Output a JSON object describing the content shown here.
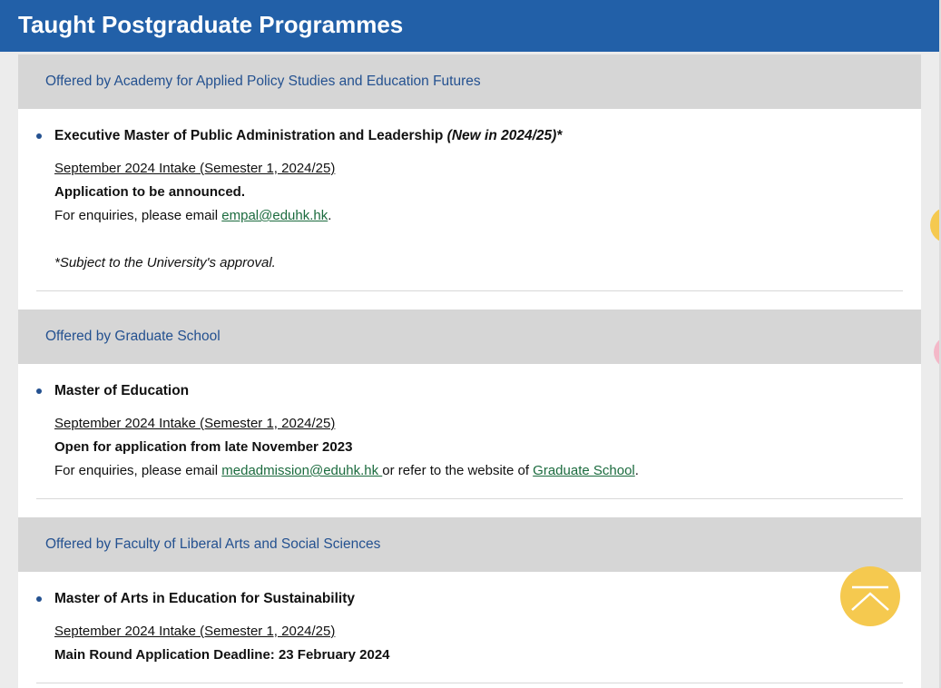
{
  "page": {
    "title": "Taught Postgraduate Programmes"
  },
  "sections": [
    {
      "offered_by": "Offered by Academy for Applied Policy Studies and Education Futures",
      "programme": {
        "title": "Executive Master of Public Administration and Leadership",
        "tag": "(New in 2024/25)*",
        "intake": "September 2024 Intake (Semester 1, 2024/25)",
        "status": "Application to be announced.",
        "enquiry_prefix": "For enquiries, please email ",
        "email": "empal@eduhk.hk",
        "enquiry_suffix": ".",
        "note": "*Subject to the University's approval."
      }
    },
    {
      "offered_by": "Offered by Graduate School",
      "programme": {
        "title": "Master of Education",
        "intake": "September 2024 Intake (Semester 1, 2024/25)",
        "status": "Open for application from late November 2023",
        "enquiry_prefix": "For enquiries, please email ",
        "email": "medadmission@eduhk.hk ",
        "enquiry_middle": "or refer to the website of ",
        "website_link": "Graduate School",
        "enquiry_suffix": "."
      }
    },
    {
      "offered_by": "Offered by Faculty of Liberal Arts and Social Sciences",
      "programme": {
        "title": "Master of Arts in Education for Sustainability",
        "intake": "September 2024 Intake (Semester 1, 2024/25)",
        "status": "Main Round Application Deadline: 23 February 2024"
      }
    }
  ],
  "icons": {
    "back_to_top": "chevron-up-icon"
  },
  "colors": {
    "header": "#2260a8",
    "section_title": "#245190",
    "link": "#1b6b3e",
    "back_to_top": "#f5c94f"
  }
}
